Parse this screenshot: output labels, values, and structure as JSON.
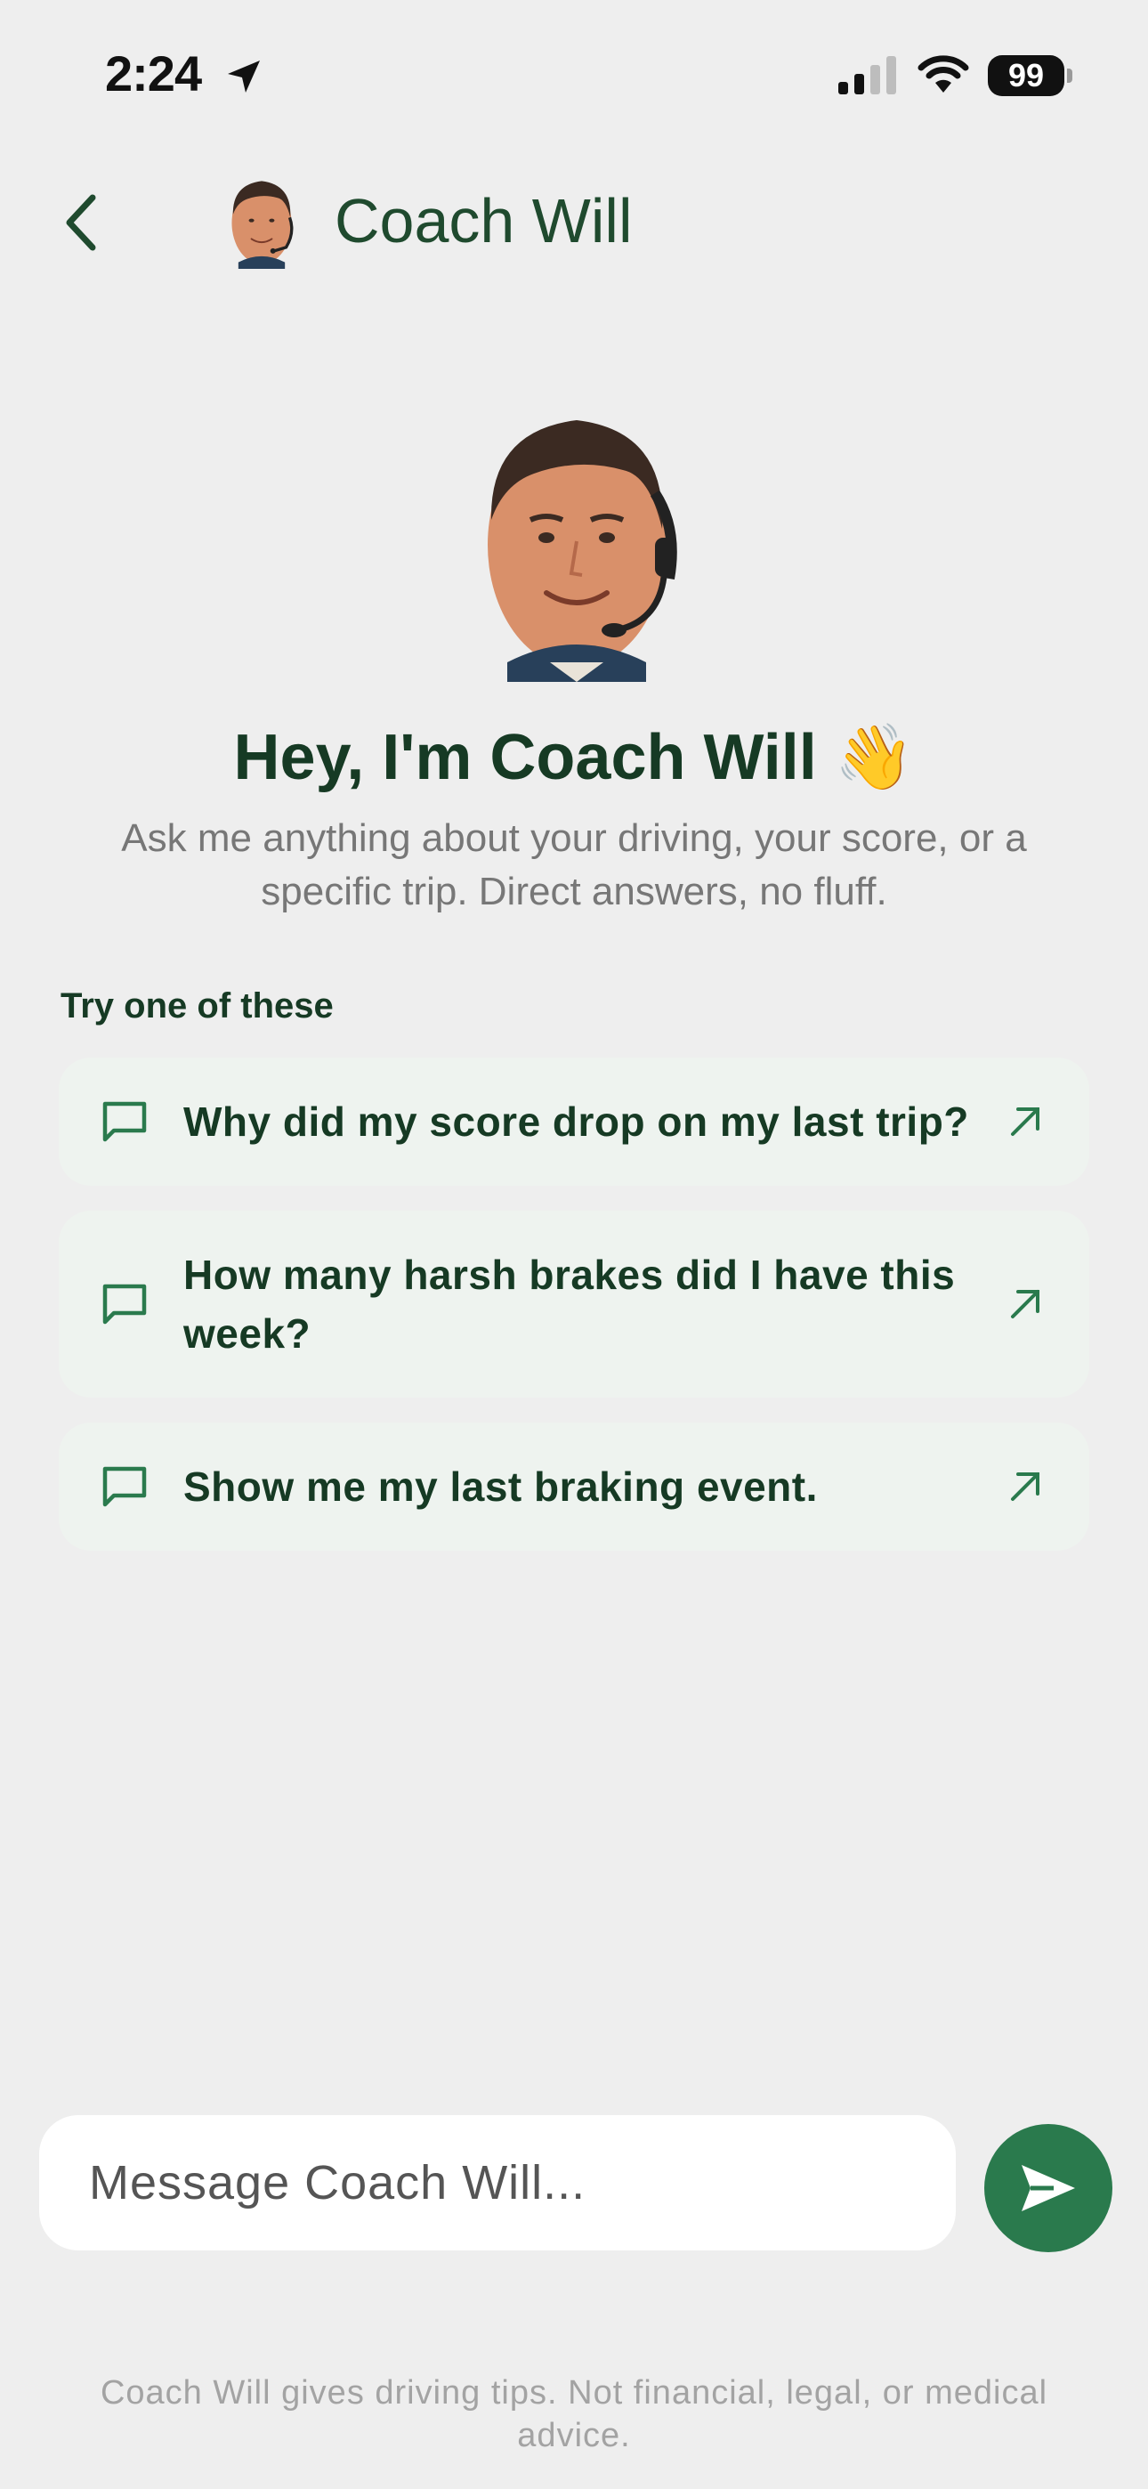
{
  "status_bar": {
    "time": "2:24",
    "battery": "99",
    "icons": [
      "location-arrow-icon",
      "cellular-signal-icon",
      "wifi-icon",
      "battery-icon"
    ]
  },
  "header": {
    "back_icon": "chevron-left-icon",
    "title": "Coach Will"
  },
  "hero": {
    "title": "Hey, I'm Coach Will 👋",
    "subtitle": "Ask me anything about your driving, your score, or a specific trip. Direct answers, no fluff."
  },
  "suggestions": {
    "label": "Try one of these",
    "items": [
      {
        "text": "Why did my score drop on my last trip?",
        "icon": "chat-bubble-icon",
        "action_icon": "arrow-up-right-icon"
      },
      {
        "text": "How many harsh brakes did I have this week?",
        "icon": "chat-bubble-icon",
        "action_icon": "arrow-up-right-icon"
      },
      {
        "text": "Show me my last braking event.",
        "icon": "chat-bubble-icon",
        "action_icon": "arrow-up-right-icon"
      }
    ]
  },
  "composer": {
    "placeholder": "Message Coach Will...",
    "send_icon": "send-icon"
  },
  "disclaimer": "Coach Will gives driving tips. Not financial, legal, or medical advice.",
  "colors": {
    "background": "#eeeeee",
    "accent": "#2a7a4d",
    "text_dark_green": "#163a24",
    "card_bg": "#eef3ef"
  }
}
